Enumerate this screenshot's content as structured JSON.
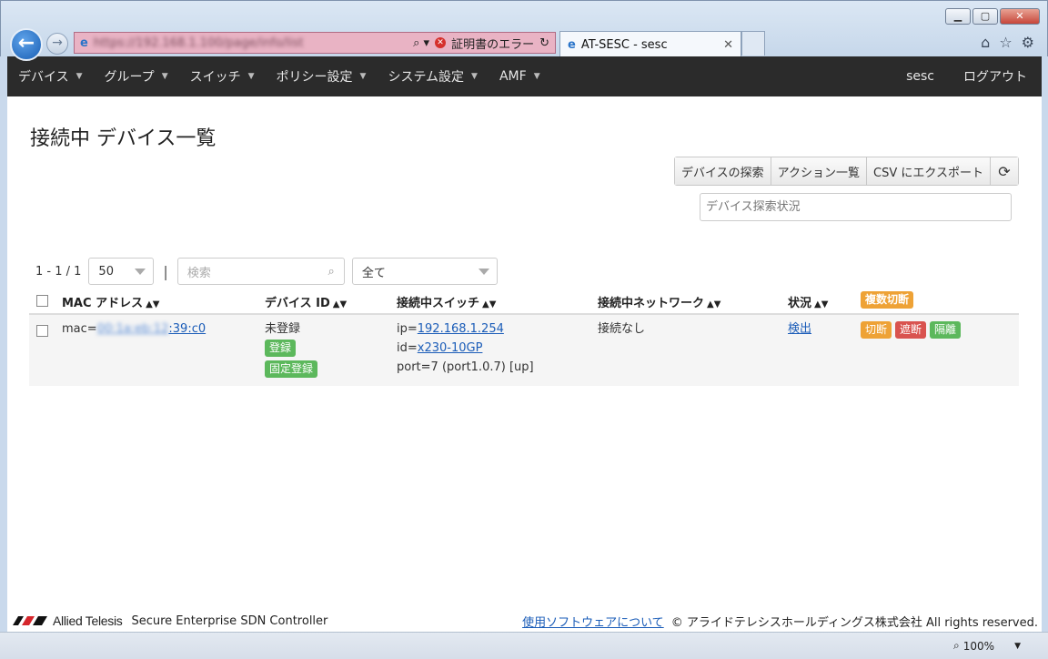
{
  "browser": {
    "address_url": "https://192.168.1.100/page/info/list",
    "cert_error": "証明書のエラー",
    "tab_title": "AT-SESC - sesc",
    "zoom": "100%"
  },
  "nav": {
    "items": [
      "デバイス",
      "グループ",
      "スイッチ",
      "ポリシー設定",
      "システム設定",
      "AMF"
    ],
    "user": "sesc",
    "logout": "ログアウト"
  },
  "page": {
    "title": "接続中 デバイス一覧",
    "actions": [
      "デバイスの探索",
      "アクション一覧",
      "CSV にエクスポート"
    ],
    "status_placeholder": "デバイス探索状況"
  },
  "controls": {
    "range": "1 - 1 / 1",
    "per_page": "50",
    "search_placeholder": "検索",
    "filter": "全て"
  },
  "table": {
    "headers": {
      "mac": "MAC アドレス",
      "device_id": "デバイス ID",
      "switch": "接続中スイッチ",
      "network": "接続中ネットワーク",
      "status": "状況",
      "bulk_disconnect": "複数切断"
    },
    "rows": [
      {
        "mac_prefix": "mac=",
        "mac_hidden": "00:1a:eb:12",
        "mac_suffix": ":39:c0",
        "device_status": "未登録",
        "register_btn": "登録",
        "fixed_register_btn": "固定登録",
        "ip_label": "ip=",
        "ip": "192.168.1.254",
        "id_label": "id=",
        "switch_id": "x230-10GP",
        "port": "port=7 (port1.0.7) [up]",
        "network": "接続なし",
        "status": "検出",
        "actions": [
          "切断",
          "遮断",
          "隔離"
        ]
      }
    ]
  },
  "footer": {
    "brand": "Allied Telesis",
    "product": "Secure Enterprise SDN Controller",
    "software_link": "使用ソフトウェアについて",
    "copyright": "© アライドテレシスホールディングス株式会社 All rights reserved."
  },
  "colors": {
    "navbar_bg": "#2b2b2b",
    "link": "#1a5cb8",
    "badge_orange": "#eea236",
    "badge_red": "#d9534f",
    "badge_green": "#5cb85c",
    "address_error_bg": "#e9b3c4"
  }
}
